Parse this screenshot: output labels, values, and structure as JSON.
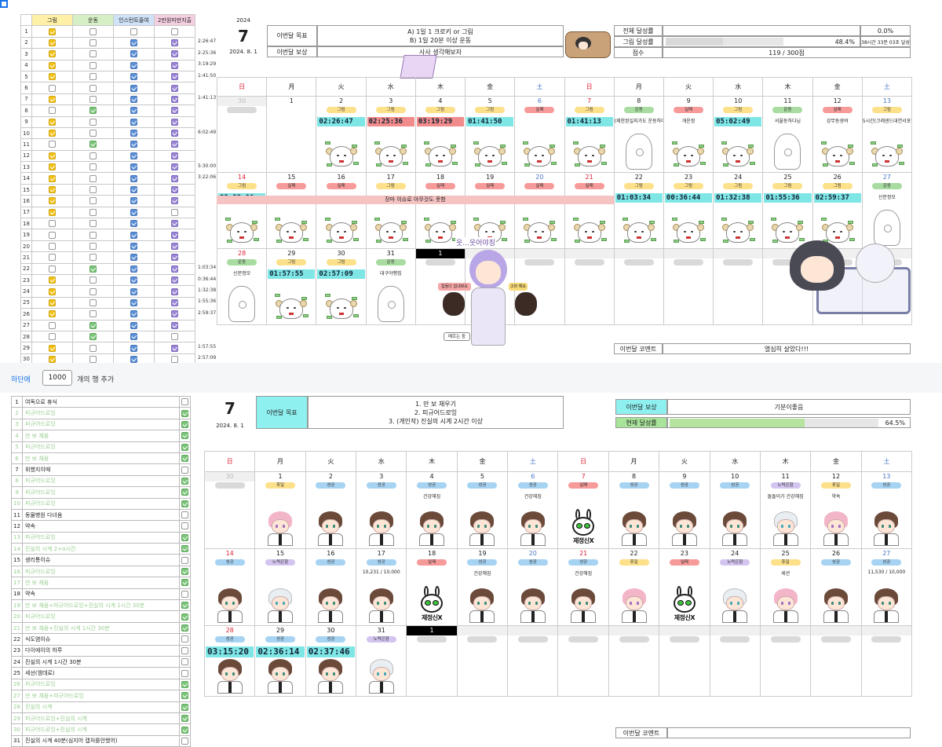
{
  "top": {
    "header_labels": [
      "그림",
      "운동",
      "인스턴트줄여",
      "2만원미만지출"
    ],
    "header_colors": [
      "#fff0a8",
      "#d6efc4",
      "#cfe2f8",
      "#f4cfe0"
    ],
    "rows": [
      [
        1,
        [
          1,
          0,
          0,
          0
        ]
      ],
      [
        2,
        [
          1,
          0,
          1,
          1
        ]
      ],
      [
        3,
        [
          1,
          0,
          1,
          1
        ]
      ],
      [
        4,
        [
          1,
          0,
          1,
          1
        ]
      ],
      [
        5,
        [
          1,
          0,
          1,
          1
        ]
      ],
      [
        6,
        [
          0,
          0,
          1,
          1
        ]
      ],
      [
        7,
        [
          1,
          0,
          1,
          1
        ]
      ],
      [
        8,
        [
          0,
          1,
          1,
          1
        ]
      ],
      [
        9,
        [
          1,
          0,
          1,
          1
        ]
      ],
      [
        10,
        [
          1,
          0,
          1,
          1
        ]
      ],
      [
        11,
        [
          0,
          1,
          1,
          1
        ]
      ],
      [
        12,
        [
          1,
          0,
          1,
          1
        ]
      ],
      [
        13,
        [
          1,
          0,
          1,
          1
        ]
      ],
      [
        14,
        [
          1,
          0,
          1,
          1
        ]
      ],
      [
        15,
        [
          1,
          0,
          1,
          1
        ]
      ],
      [
        16,
        [
          1,
          0,
          1,
          1
        ]
      ],
      [
        17,
        [
          1,
          0,
          1,
          0
        ]
      ],
      [
        18,
        [
          0,
          0,
          1,
          1
        ]
      ],
      [
        19,
        [
          0,
          0,
          1,
          1
        ]
      ],
      [
        20,
        [
          0,
          0,
          1,
          1
        ]
      ],
      [
        21,
        [
          0,
          0,
          1,
          1
        ]
      ],
      [
        22,
        [
          0,
          1,
          1,
          1
        ]
      ],
      [
        23,
        [
          1,
          0,
          1,
          1
        ]
      ],
      [
        24,
        [
          1,
          0,
          1,
          1
        ]
      ],
      [
        25,
        [
          1,
          0,
          1,
          1
        ]
      ],
      [
        26,
        [
          1,
          0,
          1,
          1
        ]
      ],
      [
        27,
        [
          0,
          1,
          1,
          1
        ]
      ],
      [
        28,
        [
          0,
          1,
          1,
          0
        ]
      ],
      [
        29,
        [
          1,
          0,
          1,
          1
        ]
      ],
      [
        30,
        [
          1,
          0,
          1,
          0
        ]
      ],
      [
        31,
        [
          0,
          1,
          1,
          0
        ]
      ]
    ],
    "times": [
      "",
      "2:26:47",
      "2:25:36",
      "3:19:29",
      "1:41:50",
      "",
      "1:41:13",
      "",
      "",
      "6:02:49",
      "",
      "",
      "5:30:00",
      "3:22:06",
      "",
      "",
      "",
      "",
      "",
      "",
      "",
      "1:03:34",
      "0:36:44",
      "1:32:38",
      "1:55:36",
      "2:59:37",
      "",
      "",
      "1:57:55",
      "2:57:09",
      ""
    ],
    "year": "2024",
    "month": "7",
    "date": "2024. 8. 1",
    "goal_label": "이번달 목표",
    "goal_text": [
      "A) 1일 1 크로키 or 그림",
      "B) 1일 20분 이상 운동"
    ],
    "reward_label": "이번달 보상",
    "reward_text": "사사 생각해보자",
    "total_label": "전체 달성률",
    "total_val": "0.0%",
    "draw_label": "그림 달성률",
    "draw_val": "48.4%",
    "draw_pct": 48.4,
    "draw_note": "38시간 33분 03초 달성",
    "score_label": "점수",
    "score_val": "119 / 300점",
    "comment_label": "이번달 코멘트",
    "comment_text": "열심히 살았다!!!",
    "days": [
      "日",
      "月",
      "火",
      "水",
      "木",
      "金",
      "土",
      "日",
      "月",
      "火",
      "水",
      "木",
      "金",
      "土"
    ],
    "week1": [
      {
        "d": "30",
        "g": 1
      },
      {
        "d": "1"
      },
      {
        "d": "2",
        "p": "그림",
        "pc": "yellow",
        "t": "02:26:47",
        "tc": "cy",
        "s": "sheep"
      },
      {
        "d": "3",
        "p": "그림",
        "pc": "yellow",
        "t": "02:25:36",
        "tc": "rd",
        "s": "sheep"
      },
      {
        "d": "4",
        "p": "그림",
        "pc": "yellow",
        "t": "03:19:29",
        "tc": "rd",
        "s": "sheep"
      },
      {
        "d": "5",
        "p": "그림",
        "pc": "yellow",
        "t": "01:41:50",
        "tc": "cy",
        "s": "sheep"
      },
      {
        "d": "6",
        "c": "blue",
        "p": "실패",
        "pc": "red",
        "s": "sheep"
      },
      {
        "d": "7",
        "c": "red",
        "p": "그림",
        "pc": "yellow",
        "t": "01:41:13",
        "tc": "cy",
        "s": "sheep"
      },
      {
        "d": "8",
        "p": "운동",
        "pc": "green",
        "n": "(제한된일지가도 운동하다",
        "s": "ghost"
      },
      {
        "d": "9",
        "p": "실패",
        "pc": "red",
        "n": "개운정",
        "s": "sheep"
      },
      {
        "d": "10",
        "p": "그림",
        "pc": "yellow",
        "t": "05:02:49",
        "tc": "cy",
        "s": "sheep"
      },
      {
        "d": "11",
        "p": "운동",
        "pc": "green",
        "n": "서울동하다님",
        "s": "ghost"
      },
      {
        "d": "12",
        "p": "실패",
        "pc": "red",
        "n": "강무동생여",
        "s": "sheep"
      },
      {
        "d": "13",
        "c": "blue",
        "p": "그림",
        "pc": "yellow",
        "n": "5시간(크레센드대연서포함",
        "s": "sheep"
      }
    ],
    "week2": [
      {
        "d": "14",
        "c": "red",
        "p": "그림",
        "pc": "yellow",
        "t": "03:22:06",
        "tc": "cy",
        "s": "sheep"
      },
      {
        "d": "15",
        "p": "실패",
        "pc": "red",
        "s": "sheep"
      },
      {
        "d": "16",
        "p": "실패",
        "pc": "red",
        "s": "sheep"
      },
      {
        "d": "17",
        "p": "그림",
        "pc": "yellow",
        "s": "sheep"
      },
      {
        "d": "18",
        "p": "실패",
        "pc": "red",
        "s": "sheep"
      },
      {
        "d": "19",
        "p": "실패",
        "pc": "red",
        "s": "sheep"
      },
      {
        "d": "20",
        "c": "blue",
        "p": "실패",
        "pc": "red",
        "s": "sheep"
      },
      {
        "d": "21",
        "c": "red",
        "p": "실패",
        "pc": "red",
        "s": "sheep"
      },
      {
        "d": "22",
        "p": "그림",
        "pc": "yellow",
        "t": "01:03:34",
        "tc": "cy",
        "s": "sheep"
      },
      {
        "d": "23",
        "p": "그림",
        "pc": "yellow",
        "t": "00:36:44",
        "tc": "cy",
        "s": "sheep"
      },
      {
        "d": "24",
        "p": "그림",
        "pc": "yellow",
        "t": "01:32:38",
        "tc": "cy",
        "s": "sheep"
      },
      {
        "d": "25",
        "p": "그림",
        "pc": "yellow",
        "t": "01:55:36",
        "tc": "cy",
        "s": "sheep"
      },
      {
        "d": "26",
        "p": "그림",
        "pc": "yellow",
        "t": "02:59:37",
        "tc": "cy",
        "s": "sheep"
      },
      {
        "d": "27",
        "c": "blue",
        "p": "운동",
        "pc": "green",
        "n": "신문정모",
        "s": "ghost"
      }
    ],
    "week2_band": "장마 이슈로 아무것도 못함",
    "week3": [
      {
        "d": "28",
        "c": "red",
        "p": "운동",
        "pc": "green",
        "n": "신문정모",
        "s": "ghost"
      },
      {
        "d": "29",
        "p": "그림",
        "pc": "yellow",
        "t": "01:57:55",
        "tc": "cy",
        "s": "sheep"
      },
      {
        "d": "30",
        "p": "그림",
        "pc": "yellow",
        "t": "02:57:09",
        "tc": "cy",
        "s": "sheep"
      },
      {
        "d": "31",
        "p": "운동",
        "pc": "green",
        "n": "대구야행집",
        "s": "ghost"
      },
      {
        "d": "1",
        "blk": 1
      },
      {
        "d": "",
        "g": 1
      },
      {
        "d": "",
        "g": 1
      },
      {
        "d": "",
        "g": 1
      },
      {
        "d": "",
        "g": 1
      },
      {
        "d": "",
        "g": 1
      },
      {
        "d": "",
        "g": 1
      },
      {
        "d": "",
        "g": 1
      },
      {
        "d": "",
        "g": 1
      },
      {
        "d": "",
        "g": 1
      }
    ],
    "sticker_text": "웃...웃어야징",
    "sticker_badges": [
      "힘들다 힘내봐요",
      "고마 해요",
      "메르는 중"
    ]
  },
  "strip": {
    "label": "하단에",
    "count": "1000",
    "suffix": "개의 행 추가"
  },
  "bottom": {
    "list": [
      [
        1,
        "여독으로 휴식",
        0,
        0
      ],
      [
        2,
        "피규어드로잉",
        1,
        1
      ],
      [
        3,
        "피규어드로잉",
        1,
        1
      ],
      [
        4,
        "만 보 채움",
        1,
        1
      ],
      [
        5,
        "피규어드로잉",
        1,
        1
      ],
      [
        6,
        "만 보 채움",
        1,
        1
      ],
      [
        7,
        "위했지이때",
        0,
        0
      ],
      [
        8,
        "피규어드로잉",
        1,
        1
      ],
      [
        9,
        "피규어드로잉",
        1,
        1
      ],
      [
        10,
        "피규어드로잉",
        1,
        1
      ],
      [
        11,
        "동물병원 다녀옴",
        0,
        0
      ],
      [
        12,
        "약속",
        0,
        0
      ],
      [
        13,
        "피규어드로잉",
        1,
        1
      ],
      [
        14,
        "진실의 시계 2+α시간",
        1,
        1
      ],
      [
        15,
        "생리통이슈",
        0,
        0
      ],
      [
        16,
        "피규어드로잉",
        1,
        1
      ],
      [
        17,
        "만 보 채움",
        1,
        1
      ],
      [
        18,
        "약속",
        0,
        0
      ],
      [
        19,
        "만 보 채움+피규어드로잉+진실의 시계 1시간 30분",
        1,
        1
      ],
      [
        20,
        "피규어드로잉",
        1,
        1
      ],
      [
        21,
        "만 보 채움+진실의 시계 1시간 30분",
        1,
        1
      ],
      [
        22,
        "식도염이슈",
        0,
        0
      ],
      [
        23,
        "다이에이의 하루",
        0,
        0
      ],
      [
        24,
        "진실의 시계 1시간 30분",
        0,
        0
      ],
      [
        25,
        "세선(엠데로)",
        0,
        0
      ],
      [
        26,
        "피규어드로잉",
        1,
        1
      ],
      [
        27,
        "만 보 채움+피규어드로잉",
        1,
        1
      ],
      [
        28,
        "진실의 시계",
        1,
        1
      ],
      [
        29,
        "피규어드로잉+진실의 시계",
        1,
        1
      ],
      [
        30,
        "피규어드로잉+진실의 시계",
        1,
        1
      ],
      [
        31,
        "진실의 시계 40분(심지어 캡처를안했어)",
        0,
        0
      ]
    ],
    "month": "7",
    "date": "2024. 8. 1",
    "goal_label": "이번달 목표",
    "goal_text": [
      "1. 만 보 채우기",
      "2. 피규어드로잉",
      "3. (개인작) 진실의 시계 2시간 이상"
    ],
    "reward_label": "이번달 보상",
    "reward_text": "기분이좋음",
    "rate_label": "현재 달성률",
    "rate_val": "64.5%",
    "rate_pct": 64.5,
    "comment_label": "이번달 코멘트",
    "days": [
      "日",
      "月",
      "火",
      "水",
      "木",
      "金",
      "土",
      "日",
      "月",
      "火",
      "水",
      "木",
      "金",
      "土"
    ],
    "week1": [
      {
        "d": "30",
        "g": 1
      },
      {
        "d": "1",
        "p": "휴일",
        "pc": "yellow",
        "s": "girl"
      },
      {
        "d": "2",
        "p": "성공",
        "pc": "blue",
        "s": "boy"
      },
      {
        "d": "3",
        "p": "성공",
        "pc": "blue",
        "s": "boy"
      },
      {
        "d": "4",
        "p": "성공",
        "pc": "blue",
        "n": "건강해짐",
        "s": "boy"
      },
      {
        "d": "5",
        "p": "성공",
        "pc": "blue",
        "s": "boy"
      },
      {
        "d": "6",
        "c": "blue",
        "p": "성공",
        "pc": "blue",
        "n": "건강해짐",
        "s": "boy"
      },
      {
        "d": "7",
        "c": "red",
        "p": "실패",
        "pc": "red",
        "s": "alien"
      },
      {
        "d": "8",
        "p": "성공",
        "pc": "blue",
        "s": "boy"
      },
      {
        "d": "9",
        "p": "성공",
        "pc": "blue",
        "s": "boy"
      },
      {
        "d": "10",
        "p": "성공",
        "pc": "blue",
        "s": "boy"
      },
      {
        "d": "11",
        "p": "노력은함",
        "pc": "purple",
        "n": "돌돌이가 건강해짐",
        "s": "silver"
      },
      {
        "d": "12",
        "p": "휴일",
        "pc": "yellow",
        "n": "약속",
        "s": "girl"
      },
      {
        "d": "13",
        "c": "blue",
        "p": "성공",
        "pc": "blue",
        "s": "boy"
      }
    ],
    "week2": [
      {
        "d": "14",
        "c": "red",
        "p": "성공",
        "pc": "blue",
        "s": "boy"
      },
      {
        "d": "15",
        "p": "노력은함",
        "pc": "purple",
        "s": "silver"
      },
      {
        "d": "16",
        "p": "성공",
        "pc": "blue",
        "s": "boy"
      },
      {
        "d": "17",
        "p": "성공",
        "pc": "blue",
        "n": "10,231 / 10,000",
        "s": "boy"
      },
      {
        "d": "18",
        "p": "실패",
        "pc": "red",
        "s": "alien"
      },
      {
        "d": "19",
        "p": "성공",
        "pc": "blue",
        "n": "건강해짐",
        "s": "boy"
      },
      {
        "d": "20",
        "c": "blue",
        "p": "성공",
        "pc": "blue",
        "s": "boy"
      },
      {
        "d": "21",
        "c": "red",
        "p": "성공",
        "pc": "blue",
        "n": "건강해짐",
        "s": "boy"
      },
      {
        "d": "22",
        "p": "휴일",
        "pc": "yellow",
        "s": "girl"
      },
      {
        "d": "23",
        "p": "실패",
        "pc": "red",
        "s": "alien"
      },
      {
        "d": "24",
        "p": "노력은함",
        "pc": "purple",
        "s": "silver"
      },
      {
        "d": "25",
        "p": "휴일",
        "pc": "yellow",
        "n": "세션",
        "s": "girl"
      },
      {
        "d": "26",
        "p": "성공",
        "pc": "blue",
        "s": "boy"
      },
      {
        "d": "27",
        "c": "blue",
        "p": "성공",
        "pc": "blue",
        "n": "11,530 / 10,000",
        "s": "boy"
      }
    ],
    "week3": [
      {
        "d": "28",
        "c": "red",
        "p": "성공",
        "pc": "blue",
        "t": "03:15:20",
        "tc": "cy",
        "s": "boy"
      },
      {
        "d": "29",
        "p": "성공",
        "pc": "blue",
        "t": "02:36:14",
        "tc": "cy",
        "s": "boy"
      },
      {
        "d": "30",
        "p": "성공",
        "pc": "blue",
        "t": "02:37:46",
        "tc": "cy",
        "s": "boy"
      },
      {
        "d": "31",
        "p": "노력은함",
        "pc": "purple",
        "s": "silver"
      },
      {
        "d": "1",
        "blk": 1
      },
      {
        "d": "",
        "g": 1
      },
      {
        "d": "",
        "g": 1
      },
      {
        "d": "",
        "g": 1
      },
      {
        "d": "",
        "g": 1
      },
      {
        "d": "",
        "g": 1
      },
      {
        "d": "",
        "g": 1
      },
      {
        "d": "",
        "g": 1
      },
      {
        "d": "",
        "g": 1
      },
      {
        "d": "",
        "g": 1
      }
    ],
    "alien_text": "제정신X"
  }
}
